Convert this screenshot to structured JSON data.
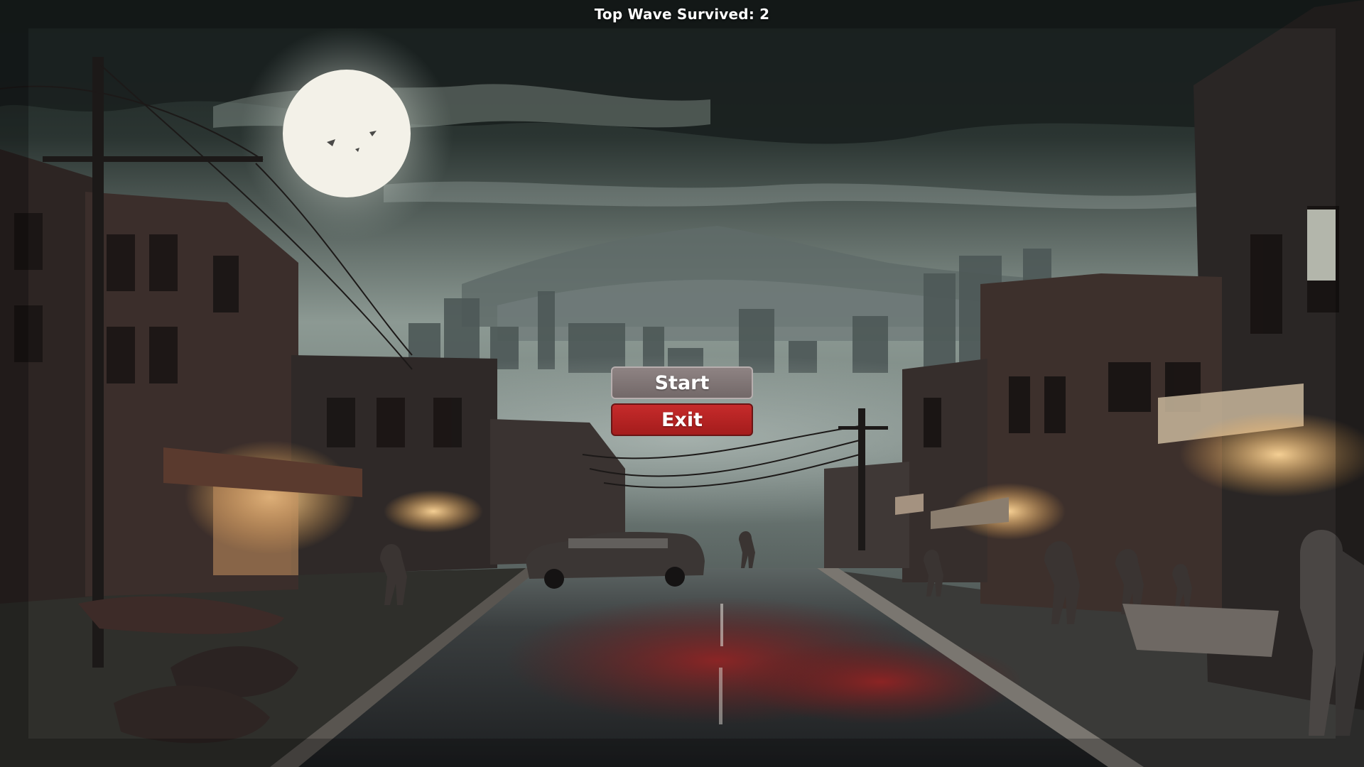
{
  "hud": {
    "top_wave_text": "Top Wave Survived: 2"
  },
  "menu": {
    "start_label": "Start",
    "exit_label": "Exit"
  },
  "colors": {
    "sky_top": "#1d2523",
    "sky_glow": "#8c9a93",
    "moon": "#f1efe7",
    "start_button": "#7f7676",
    "exit_button": "#b52424",
    "blood": "#7e1f1f",
    "road": "#2a2b2d"
  }
}
